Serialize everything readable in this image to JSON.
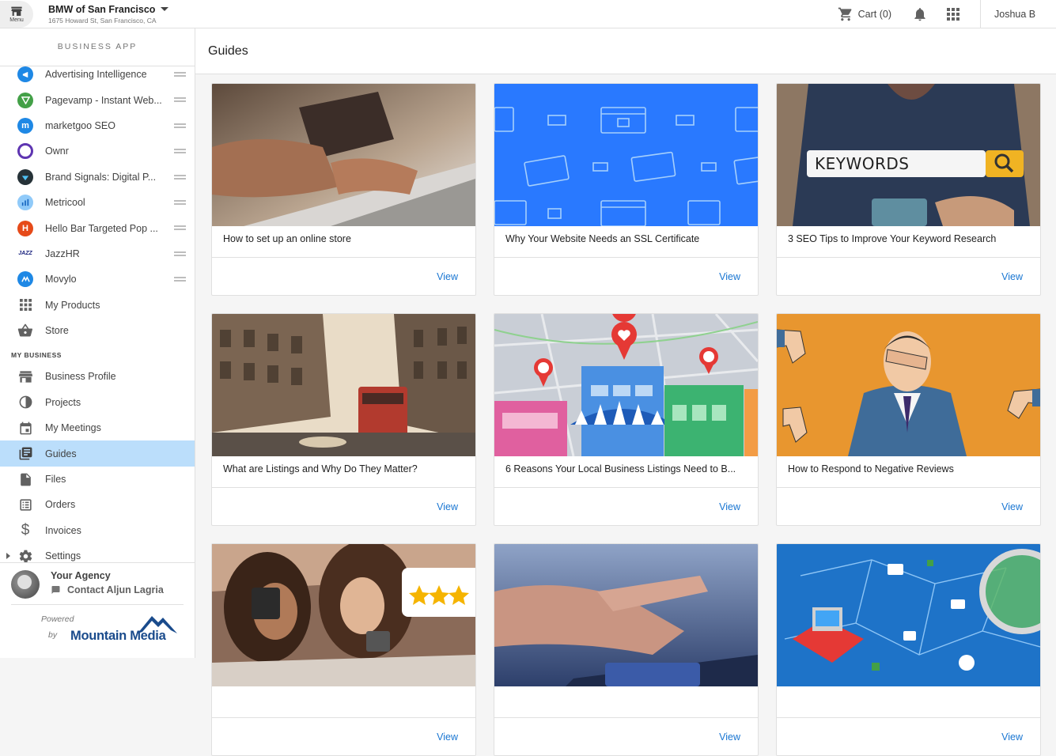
{
  "topbar": {
    "menu_label": "Menu",
    "business_name": "BMW of San Francisco",
    "business_address": "1675 Howard St, San Francisco, CA",
    "cart_label": "Cart (0)",
    "user_name": "Joshua B"
  },
  "sidebar": {
    "header": "BUSINESS APP",
    "apps": [
      {
        "label": "Advertising Intelligence",
        "icon": "megaphone-icon",
        "color": "#1e88e5"
      },
      {
        "label": "Pagevamp - Instant Web...",
        "icon": "pagevamp-icon",
        "color": "#43a047"
      },
      {
        "label": "marketgoo SEO",
        "icon": "marketgoo-icon",
        "color": "#1e88e5"
      },
      {
        "label": "Ownr",
        "icon": "ownr-icon",
        "color": "#5e35b1"
      },
      {
        "label": "Brand Signals: Digital P...",
        "icon": "brand-signals-icon",
        "color": "#212121"
      },
      {
        "label": "Metricool",
        "icon": "metricool-icon",
        "color": "#1976d2"
      },
      {
        "label": "Hello Bar Targeted Pop ...",
        "icon": "hello-bar-icon",
        "color": "#e64a19"
      },
      {
        "label": "JazzHR",
        "icon": "jazzhr-icon",
        "color": "#1a237e"
      },
      {
        "label": "Movylo",
        "icon": "movylo-icon",
        "color": "#1e88e5"
      }
    ],
    "my_products": "My Products",
    "store": "Store",
    "section_my_business": "MY BUSINESS",
    "business_items": [
      {
        "label": "Business Profile",
        "icon": "storefront-icon"
      },
      {
        "label": "Projects",
        "icon": "projects-icon"
      },
      {
        "label": "My Meetings",
        "icon": "calendar-icon"
      },
      {
        "label": "Guides",
        "icon": "guides-icon"
      },
      {
        "label": "Files",
        "icon": "file-icon"
      },
      {
        "label": "Orders",
        "icon": "orders-icon"
      },
      {
        "label": "Invoices",
        "icon": "dollar-icon"
      },
      {
        "label": "Settings",
        "icon": "gear-icon"
      }
    ],
    "agency_name": "Your Agency",
    "agency_contact": "Contact Aljun Lagria",
    "powered_label": "Powered",
    "by_label": "by",
    "powered_brand": "Mountain Media"
  },
  "main": {
    "title": "Guides",
    "view_label": "View",
    "guides": [
      {
        "title": "How to set up an online store"
      },
      {
        "title": "Why Your Website Needs an SSL Certificate"
      },
      {
        "title": "3 SEO Tips to Improve Your Keyword Research",
        "image_text": "KEYWORDS"
      },
      {
        "title": "What are Listings and Why Do They Matter?"
      },
      {
        "title": "6 Reasons Your Local Business Listings Need to B..."
      },
      {
        "title": "How to Respond to Negative Reviews"
      },
      {
        "title": ""
      },
      {
        "title": ""
      },
      {
        "title": ""
      }
    ]
  }
}
